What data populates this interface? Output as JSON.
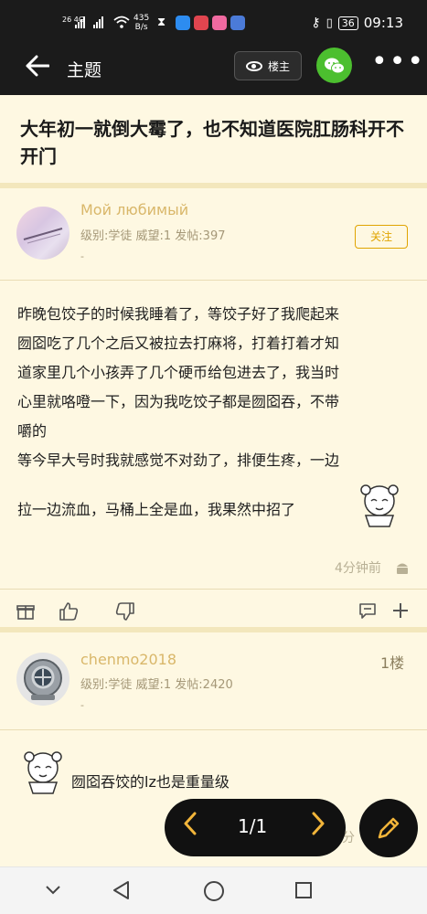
{
  "status_bar": {
    "network": "26 4G",
    "speed_value": "435",
    "speed_unit": "B/s",
    "battery": "36",
    "time": "09:13"
  },
  "nav": {
    "title": "主题",
    "louzhu_label": "楼主"
  },
  "thread": {
    "title": "大年初一就倒大霉了，也不知道医院肛肠科开不开门"
  },
  "posts": [
    {
      "username": "Мой любимый",
      "level": "级别:学徒 威望:1 发帖:397",
      "dash": "-",
      "follow_label": "关注",
      "content_lines": [
        "昨晚包饺子的时候我睡着了，等饺子好了我爬起来",
        "囫囵吃了几个之后又被拉去打麻将，打着打着才知",
        "道家里几个小孩弄了几个硬币给包进去了，我当时",
        "心里就咯噔一下，因为我吃饺子都是囫囵吞，不带",
        "嚼的",
        "等今早大号时我就感觉不对劲了，排便生疼，一边",
        "拉一边流血，马桶上全是血，我果然中招了"
      ],
      "time": "4分钟前"
    },
    {
      "username": "chenmo2018",
      "floor": "1楼",
      "level": "级别:学徒 威望:1 发帖:2420",
      "dash": "-",
      "content": "囫囵吞饺的lz也是重量级",
      "time_partial": "分"
    }
  ],
  "pager": {
    "page": "1/1"
  },
  "colors": {
    "accent": "#f2b53a",
    "background": "#fdf6dc",
    "username": "#d9b76a",
    "wechat": "#4cbf2f"
  }
}
